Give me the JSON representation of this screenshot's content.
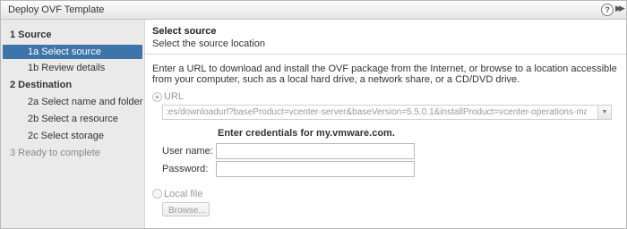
{
  "window": {
    "title": "Deploy OVF Template",
    "help_glyph": "?",
    "expand_glyph": "▶▶"
  },
  "wizard_steps": [
    {
      "label": "1  Source",
      "type": "section"
    },
    {
      "label": "1a  Select source",
      "type": "sub",
      "state": "active",
      "completed": true
    },
    {
      "label": "1b  Review details",
      "type": "sub"
    },
    {
      "label": "2  Destination",
      "type": "section"
    },
    {
      "label": "2a  Select name and folder",
      "type": "sub"
    },
    {
      "label": "2b  Select a resource",
      "type": "sub"
    },
    {
      "label": "2c  Select storage",
      "type": "sub"
    },
    {
      "label": "3  Ready to complete",
      "type": "section",
      "state": "disabled"
    }
  ],
  "main": {
    "title": "Select source",
    "subtitle": "Select the source location",
    "instructions": "Enter a URL to download and install the OVF package from the Internet, or browse to a location accessible from your computer, such as a local hard drive, a network share, or a CD/DVD drive.",
    "url_option_label": "URL",
    "url_value": ":es/downloadurl?baseProduct=vcenter-server&baseVersion=5.5.0.1&installProduct=vcenter-operations-manager",
    "credentials_heading": "Enter credentials for my.vmware.com.",
    "username_label": "User name:",
    "username_value": "",
    "password_label": "Password:",
    "password_value": "",
    "local_file_label": "Local file",
    "browse_label": "Browse..."
  },
  "icons": {
    "check": "check-icon",
    "help": "help-icon",
    "expand": "expand-icon",
    "dropdown": "chevron-down-icon"
  },
  "colors": {
    "active_step_bg": "#3d74a9",
    "check": "#4c9b32",
    "sidebar_bg": "#eaeaea"
  }
}
